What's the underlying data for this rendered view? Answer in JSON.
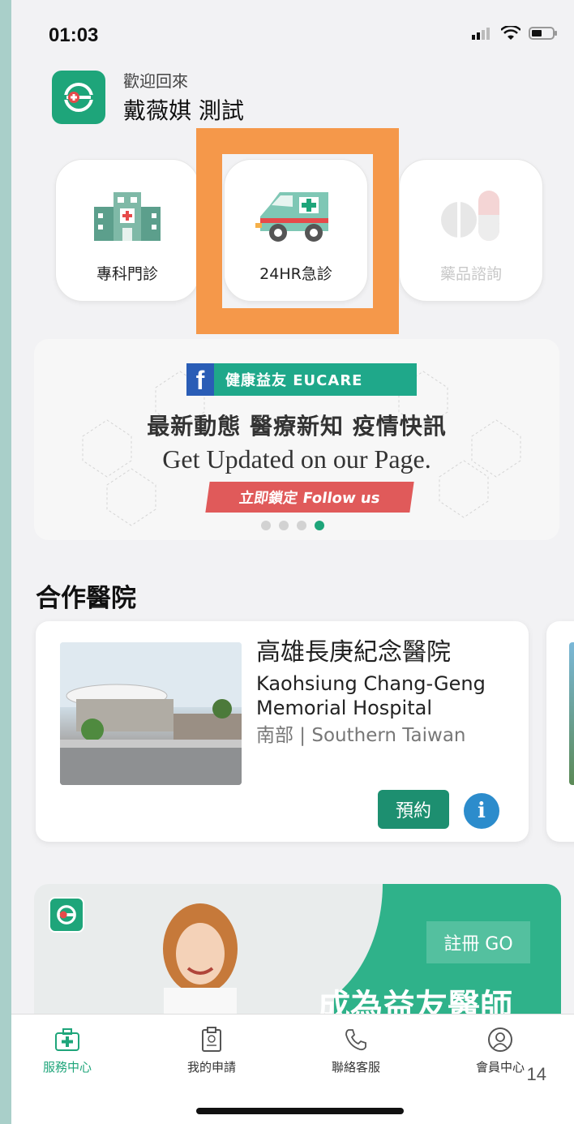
{
  "status_bar": {
    "time": "01:03"
  },
  "header": {
    "greeting": "歡迎回來",
    "user_name": "戴薇娸 測試"
  },
  "services": [
    {
      "label": "專科門診",
      "icon": "hospital-icon"
    },
    {
      "label": "24HR急診",
      "icon": "ambulance-icon"
    },
    {
      "label": "藥品諮詢",
      "icon": "pill-icon"
    }
  ],
  "banner": {
    "fb_title": "健康益友 EUCARE",
    "headline": "最新動態 醫療新知 疫情快訊",
    "subline": "Get Updated on our Page.",
    "cta": "立即鎖定 Follow us",
    "page_count": 4,
    "active_page": 4
  },
  "partners": {
    "title": "合作醫院",
    "hospitals": [
      {
        "name": "高雄長庚紀念醫院",
        "name_en": "Kaohsiung Chang-Geng Memorial Hospital",
        "region": "南部 | Southern Taiwan",
        "book_label": "預約",
        "info_label": "i"
      }
    ]
  },
  "promo": {
    "register_label": "註冊 GO",
    "headline": "成為益友醫師"
  },
  "tabs": [
    {
      "label": "服務中心",
      "icon": "medical-case-icon",
      "active": true
    },
    {
      "label": "我的申請",
      "icon": "clipboard-icon",
      "active": false
    },
    {
      "label": "聯絡客服",
      "icon": "phone-icon",
      "active": false
    },
    {
      "label": "會員中心",
      "icon": "user-icon",
      "active": false
    }
  ],
  "page_number": "14",
  "colors": {
    "brand": "#1ea57a",
    "highlight": "#f5984a",
    "info": "#2c8ccc",
    "banner_cta": "#e05a5a"
  }
}
